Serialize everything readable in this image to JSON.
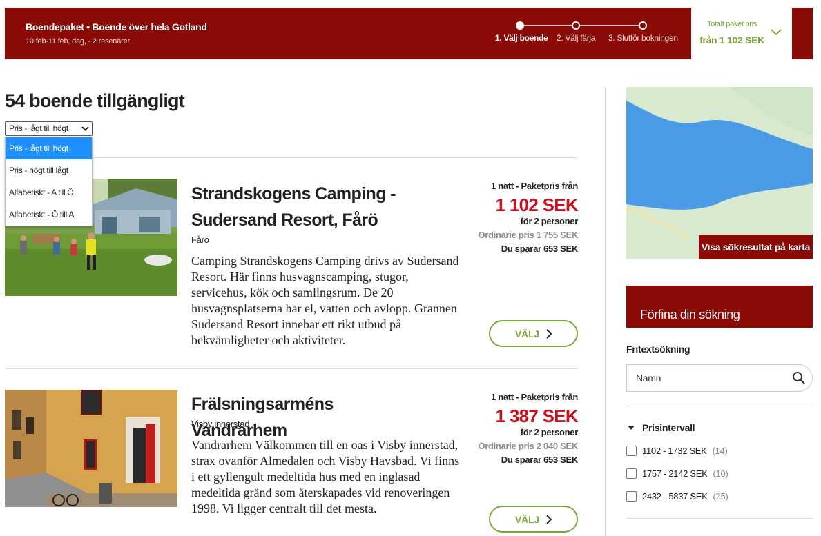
{
  "header": {
    "title": "Boendepaket • Boende över hela Gotland",
    "subtitle": "10 feb-11 feb, dag,  - 2 resenärer",
    "steps": [
      {
        "label": "1. Välj boende",
        "active": true
      },
      {
        "label": "2. Välj färja",
        "active": false
      },
      {
        "label": "3. Slutför bokningen",
        "active": false
      }
    ],
    "total_label": "Totalt paket pris",
    "total_value": "från 1 102 SEK"
  },
  "results": {
    "title": "54 boende tillgängligt",
    "sort": {
      "selected": "Pris - lågt till högt",
      "options": [
        "Pris - lågt till högt",
        "Pris - högt till lågt",
        "Alfabetiskt - A till Ö",
        "Alfabetiskt - Ö till A"
      ]
    }
  },
  "listings": [
    {
      "name": "Strandskogens Camping - Sudersand Resort, Fårö",
      "location": "Fårö",
      "description": "Camping Strandskogens Camping drivs av Sudersand Resort. Här finns husvagnscamping, stugor, servicehus, kök och samlingsrum. De 20 husvagnsplatserna har el, vatten och avlopp. Grannen Sudersand Resort innebär ett rikt utbud på bekvämligheter och aktiviteter.",
      "price_from": "1 natt - Paketpris från",
      "price": "1 102 SEK",
      "persons": "för 2 personer",
      "original": "Ordinarie pris   1 755 SEK",
      "savings": "Du sparar 653 SEK",
      "button": "VÄLJ"
    },
    {
      "name": "Frälsningsarméns Vandrarhem",
      "location": "Visby innerstad",
      "description": "Vandrarhem Välkommen till en oas i Visby innerstad, strax ovanför Almedalen och Visby Havsbad. Vi finns i ett gyllengult medeltida hus med en inglasad medeltida gränd som återskapades vid renoveringen 1998. Vi ligger centralt till det mesta.",
      "price_from": "1 natt - Paketpris från",
      "price": "1 387 SEK",
      "persons": "för 2 personer",
      "original": "Ordinarie pris   2 040 SEK",
      "savings": "Du sparar 653 SEK",
      "button": "VÄLJ"
    }
  ],
  "sidebar": {
    "map_button": "Visa sökresultat på karta",
    "refine_title": "Förfina din sökning",
    "free_text_label": "Fritextsökning",
    "search_placeholder": "Namn",
    "price_range_title": "Prisintervall",
    "price_ranges": [
      {
        "label": "1102 - 1732 SEK",
        "count": "(14)"
      },
      {
        "label": "1757 - 2142 SEK",
        "count": "(10)"
      },
      {
        "label": "2432 - 5837 SEK",
        "count": "(25)"
      }
    ]
  },
  "colors": {
    "brand_red": "#8a0b06",
    "price_red": "#c8101e",
    "accent_green": "#7ea63a",
    "selected_blue": "#1e90ff"
  }
}
